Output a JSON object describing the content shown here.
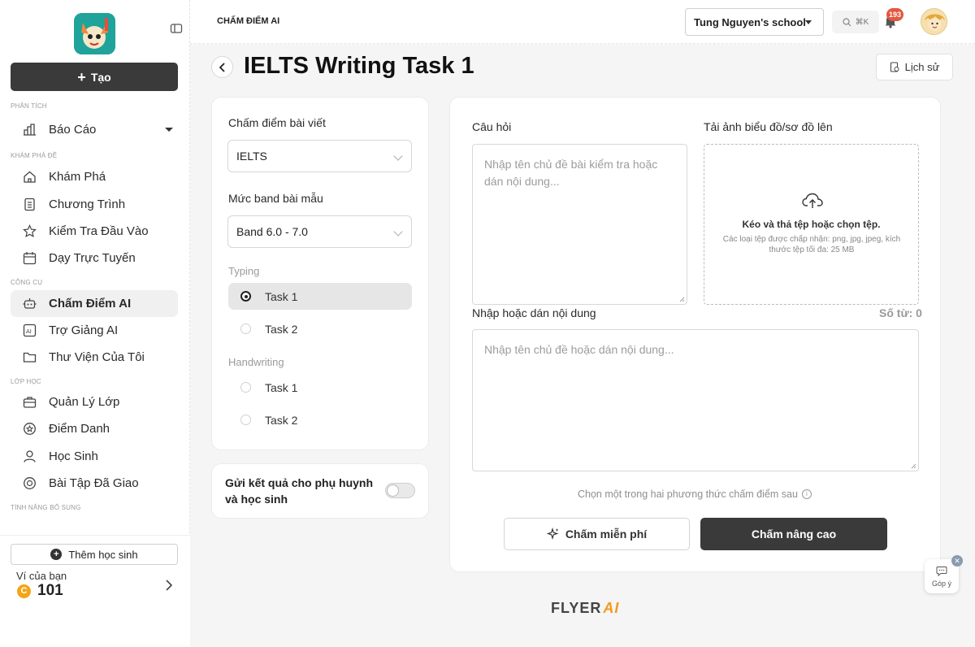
{
  "sidebar": {
    "create_label": "Tạo",
    "sections": {
      "analysis": "Phân tích",
      "explore": "Khám phá đề",
      "tools": "Công cụ",
      "classes": "Lớp học",
      "extra": "Tính năng bổ sung"
    },
    "items": {
      "reports": "Báo Cáo",
      "explore": "Khám Phá",
      "programs": "Chương Trình",
      "placement": "Kiểm Tra Đầu Vào",
      "online": "Dạy Trực Tuyến",
      "ai_grading": "Chấm Điểm AI",
      "ai_assistant": "Trợ Giảng AI",
      "library": "Thư Viện Của Tôi",
      "class_mgmt": "Quản Lý Lớp",
      "attendance": "Điểm Danh",
      "students": "Học Sinh",
      "assigned": "Bài Tập Đã Giao"
    },
    "add_student_label": "Thêm học sinh",
    "wallet_label": "Ví của bạn",
    "wallet_amount": "101",
    "coin_symbol": "C"
  },
  "header": {
    "breadcrumb": "Chấm điểm AI",
    "school": "Tung Nguyen's school",
    "search_shortcut": "⌘K",
    "notification_count": "193"
  },
  "page": {
    "title": "IELTS Writing Task 1",
    "history_label": "Lịch sử"
  },
  "left_panel": {
    "grading_label": "Chấm điểm bài viết",
    "grading_value": "IELTS",
    "band_label": "Mức band bài mẫu",
    "band_value": "Band 6.0 - 7.0",
    "typing_label": "Typing",
    "typing_task1": "Task 1",
    "typing_task2": "Task 2",
    "handwriting_label": "Handwriting",
    "hand_task1": "Task 1",
    "hand_task2": "Task 2",
    "send_results_label": "Gửi kết quả cho phụ huynh và học sinh",
    "send_results_on": false
  },
  "right_panel": {
    "question_label": "Câu hỏi",
    "question_placeholder": "Nhập tên chủ đề bài kiểm tra hoặc dán nội dung...",
    "upload_label": "Tải ảnh biểu đồ/sơ đồ lên",
    "upload_title": "Kéo và thả tệp hoặc chọn tệp.",
    "upload_hint": "Các loại tệp được chấp nhận: png, jpg, jpeg, kích thước tệp tối đa: 25 MB",
    "content_label": "Nhập hoặc dán nội dung",
    "word_count": "Số từ: 0",
    "content_placeholder": "Nhập tên chủ đề hoặc dán nội dung...",
    "choose_method": "Chọn một trong hai phương thức chấm điểm sau",
    "free_btn": "Chấm miễn phí",
    "advanced_btn": "Chấm nâng cao"
  },
  "footer": {
    "brand": "FLYER",
    "brand_ai": "AI"
  },
  "feedback": {
    "label": "Góp ý"
  },
  "colors": {
    "dark_button": "#3a3a3a",
    "accent_orange": "#f29a1f",
    "badge_red": "#e4573f"
  }
}
